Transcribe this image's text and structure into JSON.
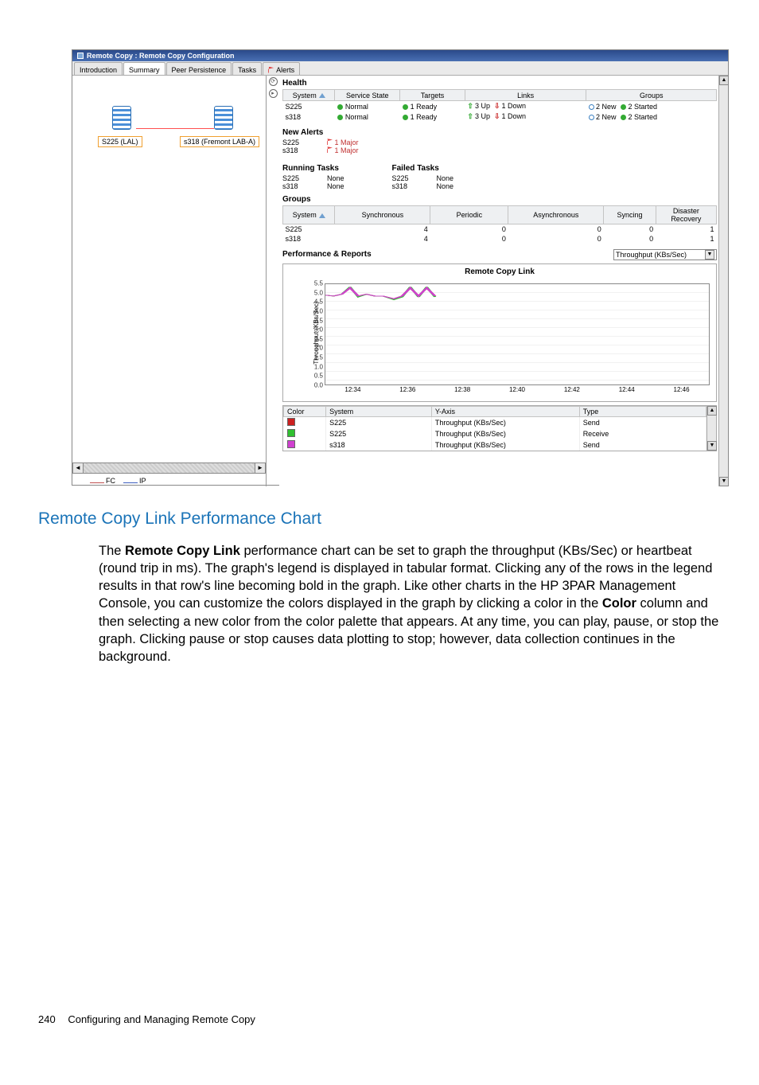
{
  "window": {
    "title": "Remote Copy : Remote Copy Configuration"
  },
  "tabs": [
    {
      "label": "Introduction"
    },
    {
      "label": "Summary",
      "selected": true
    },
    {
      "label": "Peer Persistence"
    },
    {
      "label": "Tasks"
    },
    {
      "label": "Alerts",
      "icon": "flag"
    }
  ],
  "topology": {
    "node_left": "S225 (LAL)",
    "node_right": "s318 (Fremont LAB-A)",
    "legend": [
      {
        "label": "FC",
        "color": "#c05050"
      },
      {
        "label": "IP",
        "color": "#4060c0"
      }
    ]
  },
  "health": {
    "title": "Health",
    "columns": [
      "System",
      "Service State",
      "Targets",
      "Links",
      "Groups"
    ],
    "rows": [
      {
        "system": "S225",
        "service": "Normal",
        "targets": "1 Ready",
        "links_up": "3 Up",
        "links_down": "1 Down",
        "groups_new": "2 New",
        "groups_started": "2 Started"
      },
      {
        "system": "s318",
        "service": "Normal",
        "targets": "1 Ready",
        "links_up": "3 Up",
        "links_down": "1 Down",
        "groups_new": "2 New",
        "groups_started": "2 Started"
      }
    ]
  },
  "new_alerts": {
    "title": "New Alerts",
    "rows": [
      {
        "system": "S225",
        "alert": "1 Major"
      },
      {
        "system": "s318",
        "alert": "1 Major"
      }
    ]
  },
  "running_tasks": {
    "title": "Running Tasks",
    "rows": [
      {
        "system": "S225",
        "value": "None"
      },
      {
        "system": "s318",
        "value": "None"
      }
    ]
  },
  "failed_tasks": {
    "title": "Failed Tasks",
    "rows": [
      {
        "system": "S225",
        "value": "None"
      },
      {
        "system": "s318",
        "value": "None"
      }
    ]
  },
  "groups": {
    "title": "Groups",
    "columns": [
      "System",
      "Synchronous",
      "Periodic",
      "Asynchronous",
      "Syncing",
      "Disaster Recovery"
    ],
    "rows": [
      {
        "system": "S225",
        "sync": "4",
        "periodic": "0",
        "async": "0",
        "syncing": "0",
        "dr": "1"
      },
      {
        "system": "s318",
        "sync": "4",
        "periodic": "0",
        "async": "0",
        "syncing": "0",
        "dr": "1"
      }
    ]
  },
  "perf": {
    "title": "Performance & Reports",
    "dropdown": "Throughput (KBs/Sec)",
    "chart_title": "Remote Copy Link",
    "ylabel": "Throughput (KBs/Sec)"
  },
  "legend_rows": {
    "cols": [
      "Color",
      "System",
      "Y-Axis",
      "Type"
    ],
    "rows": [
      {
        "c": "#cc2020",
        "sys": "S225",
        "y": "Throughput (KBs/Sec)",
        "t": "Send"
      },
      {
        "c": "#30c030",
        "sys": "S225",
        "y": "Throughput (KBs/Sec)",
        "t": "Receive"
      },
      {
        "c": "#d040d0",
        "sys": "s318",
        "y": "Throughput (KBs/Sec)",
        "t": "Send"
      }
    ]
  },
  "chart_data": {
    "type": "line",
    "title": "Remote Copy Link",
    "xlabel": "",
    "ylabel": "Throughput (KBs/Sec)",
    "ylim": [
      0.0,
      5.5
    ],
    "yticks": [
      0.0,
      0.5,
      1.0,
      1.5,
      2.0,
      2.5,
      3.0,
      3.5,
      4.0,
      4.5,
      5.0,
      5.5
    ],
    "xticks": [
      "12:34",
      "12:36",
      "12:38",
      "12:40",
      "12:42",
      "12:44",
      "12:46"
    ],
    "x_range_minutes": [
      33.0,
      47.0
    ],
    "series": [
      {
        "name": "S225 Send",
        "color": "#cc2020",
        "x": [
          33.0,
          33.3,
          33.6,
          33.9,
          34.2,
          34.5,
          34.8,
          35.1,
          35.5,
          35.8,
          36.1,
          36.4,
          36.7,
          37.0
        ],
        "y": [
          4.9,
          4.85,
          4.95,
          5.3,
          4.85,
          4.95,
          4.85,
          4.85,
          4.7,
          4.85,
          5.3,
          4.85,
          5.3,
          4.85
        ]
      },
      {
        "name": "S225 Receive",
        "color": "#30c030",
        "x": [
          33.0,
          33.3,
          33.6,
          33.9,
          34.2,
          34.5,
          34.8,
          35.1,
          35.5,
          35.8,
          36.1,
          36.4,
          36.7,
          37.0
        ],
        "y": [
          4.9,
          4.85,
          4.95,
          5.35,
          4.8,
          4.95,
          4.85,
          4.85,
          4.65,
          4.8,
          5.35,
          4.8,
          5.35,
          4.8
        ]
      },
      {
        "name": "s318 Send",
        "color": "#d040d0",
        "x": [
          33.0,
          33.3,
          33.6,
          33.9,
          34.2,
          34.5,
          34.8,
          35.1,
          35.5,
          35.8,
          36.1,
          36.4,
          36.7,
          37.0
        ],
        "y": [
          4.9,
          4.85,
          4.95,
          5.3,
          4.85,
          4.95,
          4.85,
          4.85,
          4.7,
          4.85,
          5.3,
          4.85,
          5.3,
          4.85
        ]
      }
    ]
  },
  "doc": {
    "heading": "Remote Copy Link Performance Chart",
    "para_a": "The ",
    "para_b": "Remote Copy Link",
    "para_c": " performance chart can be set to graph the throughput (KBs/Sec) or heartbeat (round trip in ms). The graph's legend is displayed in tabular format. Clicking any of the rows in the legend results in that row's line becoming bold in the graph. Like other charts in the HP 3PAR Management Console, you can customize the colors displayed in the graph by clicking a color in the ",
    "para_d": "Color",
    "para_e": " column and then selecting a new color from the color palette that appears. At any time, you can play, pause, or stop the graph. Clicking pause or stop causes data plotting to stop; however, data collection continues in the background.",
    "page_number": "240",
    "footer_text": "Configuring and Managing Remote Copy"
  }
}
